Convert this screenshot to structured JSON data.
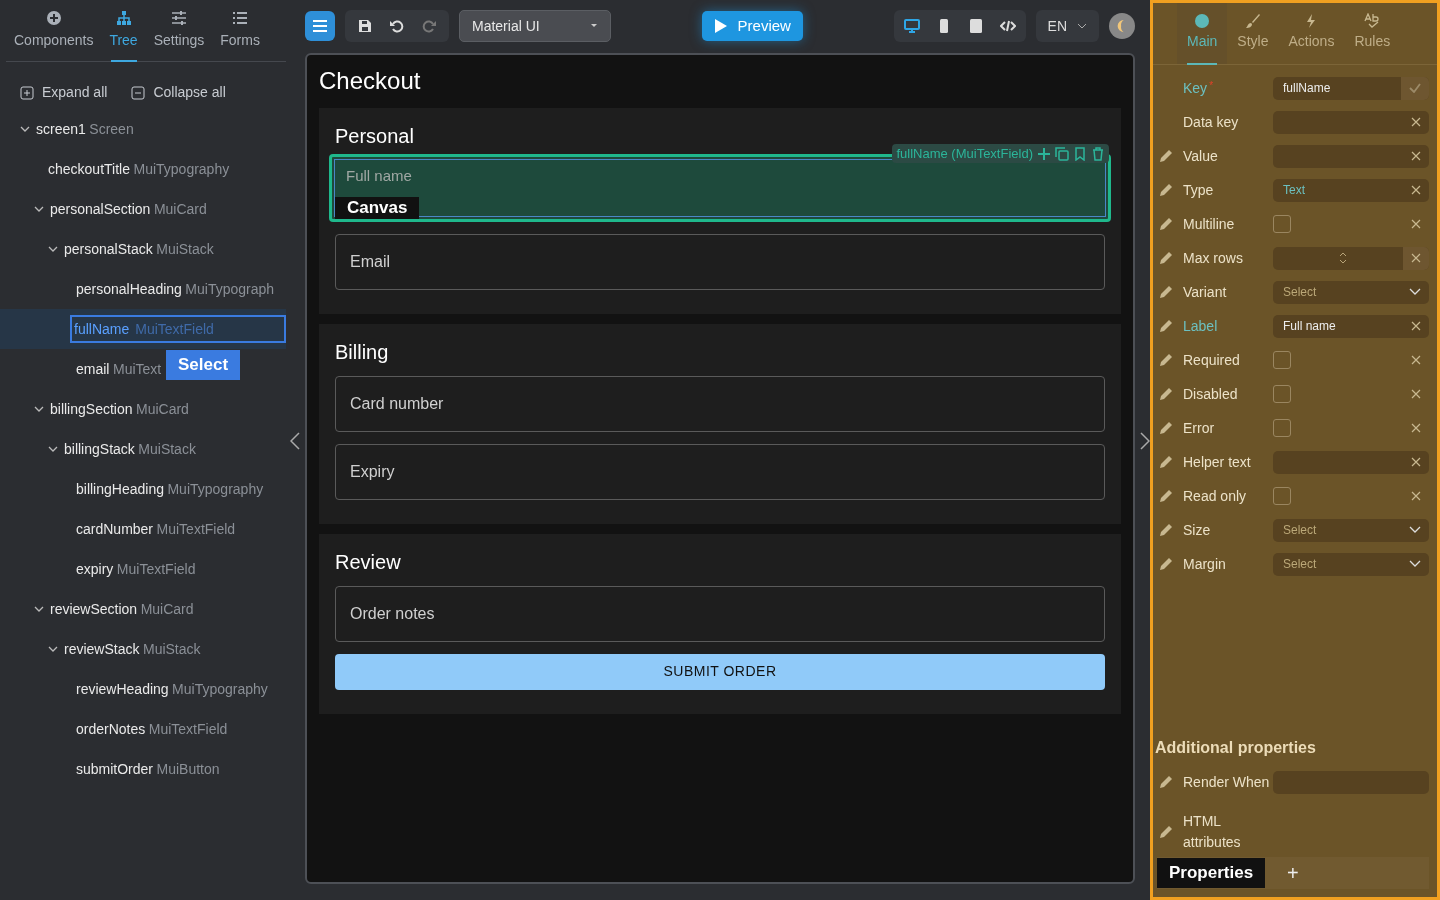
{
  "left_panel": {
    "tabs": [
      {
        "label": "Components",
        "selected": false
      },
      {
        "label": "Tree",
        "selected": true
      },
      {
        "label": "Settings",
        "selected": false
      },
      {
        "label": "Forms",
        "selected": false
      }
    ],
    "actions": [
      {
        "label": "Expand all"
      },
      {
        "label": "Collapse all"
      }
    ],
    "tree": [
      {
        "name": "screen1",
        "type": "Screen",
        "expanded": true,
        "selected": false,
        "children": [
          {
            "name": "checkoutTitle",
            "type": "MuiTypography",
            "selected": false
          },
          {
            "name": "personalSection",
            "type": "MuiCard",
            "expanded": true,
            "selected": false,
            "children": [
              {
                "name": "personalStack",
                "type": "MuiStack",
                "expanded": true,
                "selected": false,
                "children": [
                  {
                    "name": "personalHeading",
                    "type": "MuiTypograph",
                    "selected": false
                  },
                  {
                    "name": "fullName",
                    "type": "MuiTextField",
                    "selected": true
                  },
                  {
                    "name": "email",
                    "type": "MuiText",
                    "selected": false
                  }
                ]
              }
            ]
          },
          {
            "name": "billingSection",
            "type": "MuiCard",
            "expanded": true,
            "selected": false,
            "children": [
              {
                "name": "billingStack",
                "type": "MuiStack",
                "expanded": true,
                "selected": false,
                "children": [
                  {
                    "name": "billingHeading",
                    "type": "MuiTypography",
                    "selected": false
                  },
                  {
                    "name": "cardNumber",
                    "type": "MuiTextField",
                    "selected": false
                  },
                  {
                    "name": "expiry",
                    "type": "MuiTextField",
                    "selected": false
                  }
                ]
              }
            ]
          },
          {
            "name": "reviewSection",
            "type": "MuiCard",
            "expanded": true,
            "selected": false,
            "children": [
              {
                "name": "reviewStack",
                "type": "MuiStack",
                "expanded": true,
                "selected": false,
                "children": [
                  {
                    "name": "reviewHeading",
                    "type": "MuiTypography",
                    "selected": false
                  },
                  {
                    "name": "orderNotes",
                    "type": "MuiTextField",
                    "selected": false
                  },
                  {
                    "name": "submitOrder",
                    "type": "MuiButton",
                    "selected": false
                  }
                ]
              }
            ]
          }
        ]
      }
    ],
    "overlay_label": "Select"
  },
  "toolbar": {
    "library": "Material UI",
    "preview": "Preview",
    "devices": [
      {
        "selected": true
      },
      {
        "selected": false
      },
      {
        "selected": false
      },
      {
        "selected": false
      }
    ],
    "language": "EN"
  },
  "canvas": {
    "title": "Checkout",
    "overlay_label": "Canvas",
    "selection_label": "fullName (MuiTextField)",
    "sections": [
      {
        "title": "Personal",
        "items": [
          {
            "kind": "field",
            "label": "Full name",
            "selected": true
          },
          {
            "kind": "field",
            "label": "Email",
            "selected": false
          }
        ]
      },
      {
        "title": "Billing",
        "items": [
          {
            "kind": "field",
            "label": "Card number",
            "selected": false
          },
          {
            "kind": "field",
            "label": "Expiry",
            "selected": false
          }
        ]
      },
      {
        "title": "Review",
        "items": [
          {
            "kind": "field",
            "label": "Order notes",
            "selected": false
          },
          {
            "kind": "button",
            "label": "SUBMIT ORDER",
            "selected": false
          }
        ]
      }
    ]
  },
  "right_panel": {
    "tabs": [
      {
        "label": "Main",
        "selected": true
      },
      {
        "label": "Style",
        "selected": false
      },
      {
        "label": "Actions",
        "selected": false
      },
      {
        "label": "Rules",
        "selected": false
      }
    ],
    "properties": [
      {
        "label": "Key",
        "kind": "key",
        "required_mark": "*",
        "highlighted": true,
        "bindable": false,
        "value": "fullName"
      },
      {
        "label": "Data key",
        "kind": "text",
        "highlighted": false,
        "bindable": false
      },
      {
        "label": "Value",
        "kind": "text",
        "highlighted": false,
        "bindable": true
      },
      {
        "label": "Type",
        "kind": "text",
        "highlighted": false,
        "bindable": true,
        "value": "Text"
      },
      {
        "label": "Multiline",
        "kind": "checkbox",
        "highlighted": false,
        "bindable": true,
        "checked": false
      },
      {
        "label": "Max rows",
        "kind": "number",
        "highlighted": false,
        "bindable": true
      },
      {
        "label": "Variant",
        "kind": "select",
        "highlighted": false,
        "bindable": true,
        "placeholder": "Select"
      },
      {
        "label": "Label",
        "kind": "text",
        "highlighted": true,
        "bindable": true,
        "value": "Full name"
      },
      {
        "label": "Required",
        "kind": "checkbox",
        "highlighted": false,
        "bindable": true,
        "checked": false
      },
      {
        "label": "Disabled",
        "kind": "checkbox",
        "highlighted": false,
        "bindable": true,
        "checked": false
      },
      {
        "label": "Error",
        "kind": "checkbox",
        "highlighted": false,
        "bindable": true,
        "checked": false
      },
      {
        "label": "Helper text",
        "kind": "text",
        "highlighted": false,
        "bindable": true
      },
      {
        "label": "Read only",
        "kind": "checkbox",
        "highlighted": false,
        "bindable": true,
        "checked": false
      },
      {
        "label": "Size",
        "kind": "select",
        "highlighted": false,
        "bindable": true,
        "placeholder": "Select"
      },
      {
        "label": "Margin",
        "kind": "select",
        "highlighted": false,
        "bindable": true,
        "placeholder": "Select"
      }
    ],
    "additional_title": "Additional properties",
    "additional": [
      {
        "label": "Render When",
        "kind": "text",
        "bindable": true
      },
      {
        "label": "HTML attributes",
        "kind": "none",
        "bindable": true
      }
    ],
    "overlay_label": "Properties",
    "add_button": "+"
  }
}
